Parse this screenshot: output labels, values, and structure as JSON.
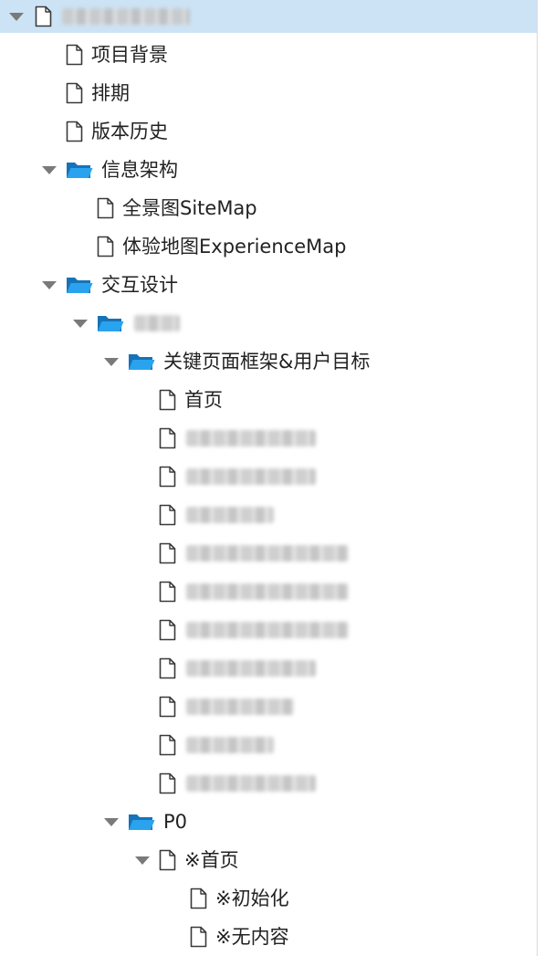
{
  "tree": {
    "items": [
      {
        "label": "",
        "icon": "file-icon",
        "caret": true,
        "depth": 0,
        "blurred": true,
        "selected": true,
        "blur_width": 140
      },
      {
        "label": "项目背景",
        "icon": "file-icon",
        "caret": false,
        "depth": 1
      },
      {
        "label": "排期",
        "icon": "file-icon",
        "caret": false,
        "depth": 1
      },
      {
        "label": "版本历史",
        "icon": "file-icon",
        "caret": false,
        "depth": 1
      },
      {
        "label": "信息架构",
        "icon": "folder-open-icon",
        "caret": true,
        "depth": 1
      },
      {
        "label": "全景图SiteMap",
        "icon": "file-icon",
        "caret": false,
        "depth": 2
      },
      {
        "label": "体验地图ExperienceMap",
        "icon": "file-icon",
        "caret": false,
        "depth": 2
      },
      {
        "label": "交互设计",
        "icon": "folder-open-icon",
        "caret": true,
        "depth": 1
      },
      {
        "label": "",
        "icon": "folder-open-icon",
        "caret": true,
        "depth": 2,
        "blurred": true,
        "blur_width": 50
      },
      {
        "label": "关键页面框架&用户目标",
        "icon": "folder-open-icon",
        "caret": true,
        "depth": 3
      },
      {
        "label": "首页",
        "icon": "file-icon",
        "caret": false,
        "depth": 4
      },
      {
        "label": "",
        "icon": "file-icon",
        "caret": false,
        "depth": 4,
        "blurred": true,
        "blur_width": 142
      },
      {
        "label": "",
        "icon": "file-icon",
        "caret": false,
        "depth": 4,
        "blurred": true,
        "blur_width": 142
      },
      {
        "label": "",
        "icon": "file-icon",
        "caret": false,
        "depth": 4,
        "blurred": true,
        "blur_width": 96
      },
      {
        "label": "",
        "icon": "file-icon",
        "caret": false,
        "depth": 4,
        "blurred": true,
        "blur_width": 178
      },
      {
        "label": "",
        "icon": "file-icon",
        "caret": false,
        "depth": 4,
        "blurred": true,
        "blur_width": 178
      },
      {
        "label": "",
        "icon": "file-icon",
        "caret": false,
        "depth": 4,
        "blurred": true,
        "blur_width": 178
      },
      {
        "label": "",
        "icon": "file-icon",
        "caret": false,
        "depth": 4,
        "blurred": true,
        "blur_width": 142
      },
      {
        "label": "",
        "icon": "file-icon",
        "caret": false,
        "depth": 4,
        "blurred": true,
        "blur_width": 118
      },
      {
        "label": "",
        "icon": "file-icon",
        "caret": false,
        "depth": 4,
        "blurred": true,
        "blur_width": 96
      },
      {
        "label": "",
        "icon": "file-icon",
        "caret": false,
        "depth": 4,
        "blurred": true,
        "blur_width": 142
      },
      {
        "label": "P0",
        "icon": "folder-open-icon",
        "caret": true,
        "depth": 3
      },
      {
        "label": "※首页",
        "icon": "file-icon",
        "caret": true,
        "depth": 4
      },
      {
        "label": "※初始化",
        "icon": "file-icon",
        "caret": false,
        "depth": 5
      },
      {
        "label": "※无内容",
        "icon": "file-icon",
        "caret": false,
        "depth": 5
      }
    ]
  },
  "colors": {
    "selected_bg": "#cce3f5",
    "folder_blue": "#2196e0",
    "caret_grey": "#7a7a7a",
    "text": "#222222"
  }
}
